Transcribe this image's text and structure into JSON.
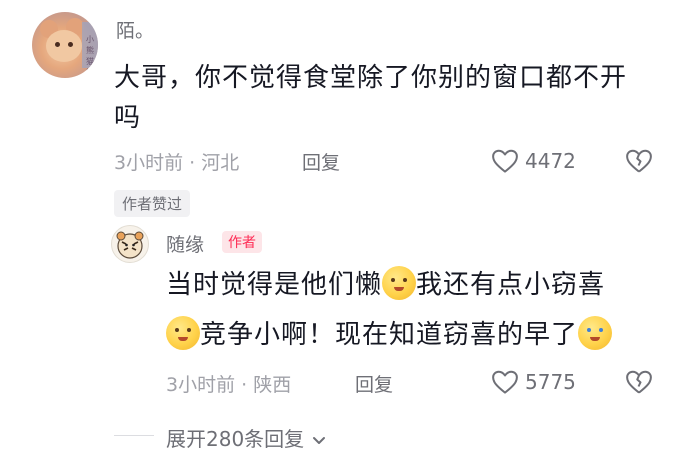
{
  "comment": {
    "username": "陌。",
    "avatar_text": "小熊猫镇",
    "text_line1": "大哥，你不觉得食堂除了你别的窗口都不开",
    "text_line2": "吗",
    "time_location": "3小时前 · 河北",
    "reply_label": "回复",
    "like_count": "4472",
    "badge": "作者赞过"
  },
  "reply": {
    "username": "随缘",
    "author_tag": "作者",
    "seg1": "当时觉得是他们懒",
    "seg2": "我还有点小窃喜",
    "seg3": "竞争小啊！现在知道窃喜的早了",
    "time_location": "3小时前 · 陕西",
    "reply_label": "回复",
    "like_count": "5775"
  },
  "expand_label": "展开280条回复",
  "icons": {
    "like": "heart-outline-icon",
    "dislike": "broken-heart-icon",
    "chevron": "chevron-down-icon"
  },
  "colors": {
    "author_tag_fg": "#fe2c55",
    "author_tag_bg": "#fde5e8"
  }
}
